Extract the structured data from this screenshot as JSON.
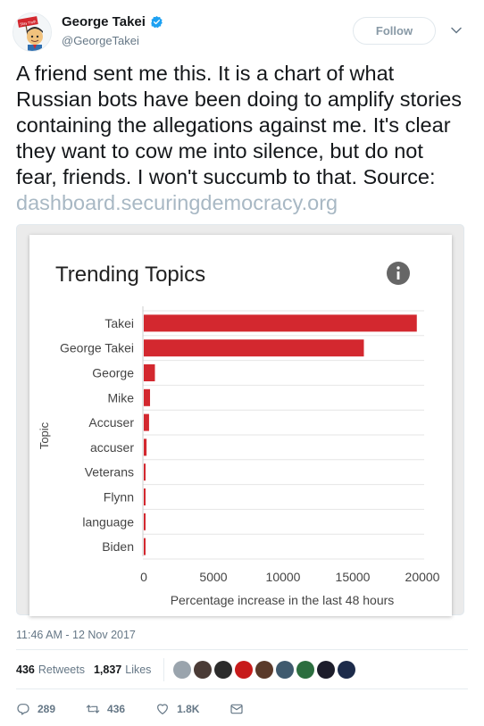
{
  "user": {
    "name": "George Takei",
    "handle": "@GeorgeTakei",
    "follow_label": "Follow",
    "avatar_sign": "Stay Truth"
  },
  "tweet": {
    "text": "A friend sent me this. It is a chart of what Russian bots have been doing to amplify stories containing the allegations against me. It's clear they want to cow me into silence, but do not fear, friends. I won't succumb to that. Source: ",
    "link": "dashboard.securingdemocracy.org",
    "timestamp": "11:46 AM - 12 Nov 2017"
  },
  "stats": {
    "retweets_count": "436",
    "retweets_label": "Retweets",
    "likes_count": "1,837",
    "likes_label": "Likes",
    "liker_colors": [
      "#9aa4ad",
      "#4a3b36",
      "#2b2b2b",
      "#c71b1b",
      "#5a3a2a",
      "#3f5a6e",
      "#2c6e3f",
      "#1d1d2b",
      "#1c2b4a"
    ]
  },
  "actions": {
    "reply_count": "289",
    "retweet_count": "436",
    "like_count": "1.8K"
  },
  "colors": {
    "bar": "#d3282f",
    "verified": "#1da1f2",
    "link": "#a8b8c4"
  },
  "chart_data": {
    "type": "bar",
    "orientation": "horizontal",
    "title": "Trending Topics",
    "categories": [
      "Takei",
      "George Takei",
      "George",
      "Mike",
      "Accuser",
      "accuser",
      "Veterans",
      "Flynn",
      "language",
      "Biden"
    ],
    "values": [
      19600,
      15800,
      800,
      450,
      380,
      200,
      130,
      110,
      100,
      90
    ],
    "xlabel": "Percentage increase in the last 48 hours",
    "ylabel": "Topic",
    "xlim": [
      0,
      20000
    ],
    "xticks": [
      "0",
      "5000",
      "10000",
      "15000",
      "20000"
    ],
    "grid": true
  }
}
